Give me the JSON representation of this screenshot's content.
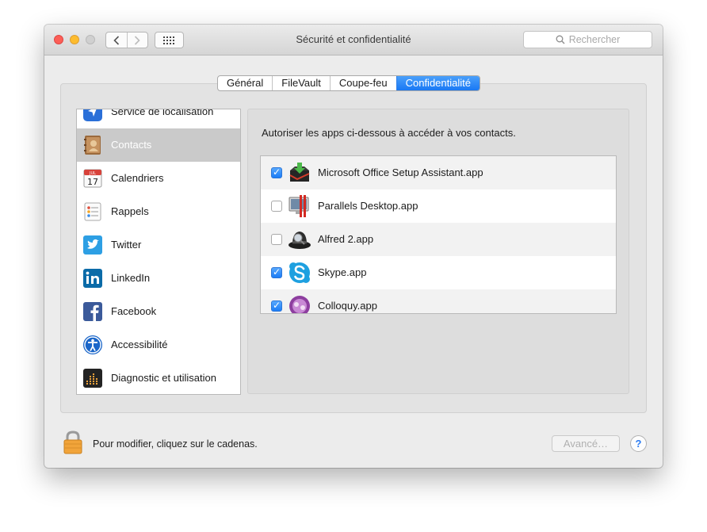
{
  "window": {
    "title": "Sécurité et confidentialité"
  },
  "search": {
    "placeholder": "Rechercher"
  },
  "tabs": [
    {
      "label": "Général",
      "active": false
    },
    {
      "label": "FileVault",
      "active": false
    },
    {
      "label": "Coupe-feu",
      "active": false
    },
    {
      "label": "Confidentialité",
      "active": true
    }
  ],
  "sidebar": {
    "items": [
      {
        "label": "Service de localisation",
        "icon": "location-arrow-icon"
      },
      {
        "label": "Contacts",
        "icon": "contacts-book-icon",
        "selected": true
      },
      {
        "label": "Calendriers",
        "icon": "calendar-icon",
        "date_label": "JUL",
        "date_number": "17"
      },
      {
        "label": "Rappels",
        "icon": "reminders-icon"
      },
      {
        "label": "Twitter",
        "icon": "twitter-icon"
      },
      {
        "label": "LinkedIn",
        "icon": "linkedin-icon"
      },
      {
        "label": "Facebook",
        "icon": "facebook-icon"
      },
      {
        "label": "Accessibilité",
        "icon": "accessibility-icon"
      },
      {
        "label": "Diagnostic et utilisation",
        "icon": "diagnostics-icon"
      }
    ]
  },
  "main": {
    "prompt": "Autoriser les apps ci-dessous à accéder à vos contacts.",
    "apps": [
      {
        "name": "Microsoft Office Setup Assistant.app",
        "checked": true,
        "icon": "office-setup-icon"
      },
      {
        "name": "Parallels Desktop.app",
        "checked": false,
        "icon": "parallels-icon"
      },
      {
        "name": "Alfred 2.app",
        "checked": false,
        "icon": "alfred-icon"
      },
      {
        "name": "Skype.app",
        "checked": true,
        "icon": "skype-icon"
      },
      {
        "name": "Colloquy.app",
        "checked": true,
        "icon": "colloquy-icon"
      }
    ]
  },
  "footer": {
    "lock_text": "Pour modifier, cliquez sur le cadenas.",
    "advanced_label": "Avancé…",
    "help_label": "?"
  },
  "colors": {
    "accent": "#1978f4",
    "selection": "#cacaca"
  }
}
